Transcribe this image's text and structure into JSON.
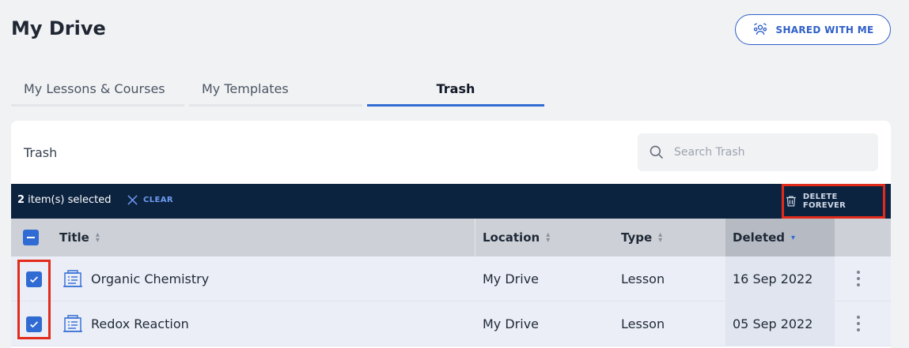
{
  "page": {
    "title": "My Drive"
  },
  "header": {
    "shared_label": "SHARED WITH ME",
    "shared_icon": "people-sharing-icon"
  },
  "tabs": [
    {
      "label": "My Lessons & Courses",
      "active": false
    },
    {
      "label": "My Templates",
      "active": false
    },
    {
      "label": "Trash",
      "active": true
    }
  ],
  "panel": {
    "title": "Trash",
    "search_placeholder": "Search Trash"
  },
  "selection": {
    "count": "2",
    "count_suffix": " item(s) selected",
    "clear_label": "CLEAR",
    "delete_label": "DELETE FOREVER"
  },
  "table": {
    "columns": {
      "title": "Title",
      "location": "Location",
      "type": "Type",
      "deleted": "Deleted"
    },
    "sorted_column": "Deleted",
    "rows": [
      {
        "title": "Organic Chemistry",
        "location": "My Drive",
        "type": "Lesson",
        "deleted": "16 Sep 2022",
        "checked": true
      },
      {
        "title": "Redox Reaction",
        "location": "My Drive",
        "type": "Lesson",
        "deleted": "05 Sep 2022",
        "checked": true
      }
    ]
  },
  "colors": {
    "accent": "#2f6bd3",
    "selection_bar": "#0c2340",
    "highlight": "#e32b1b"
  }
}
